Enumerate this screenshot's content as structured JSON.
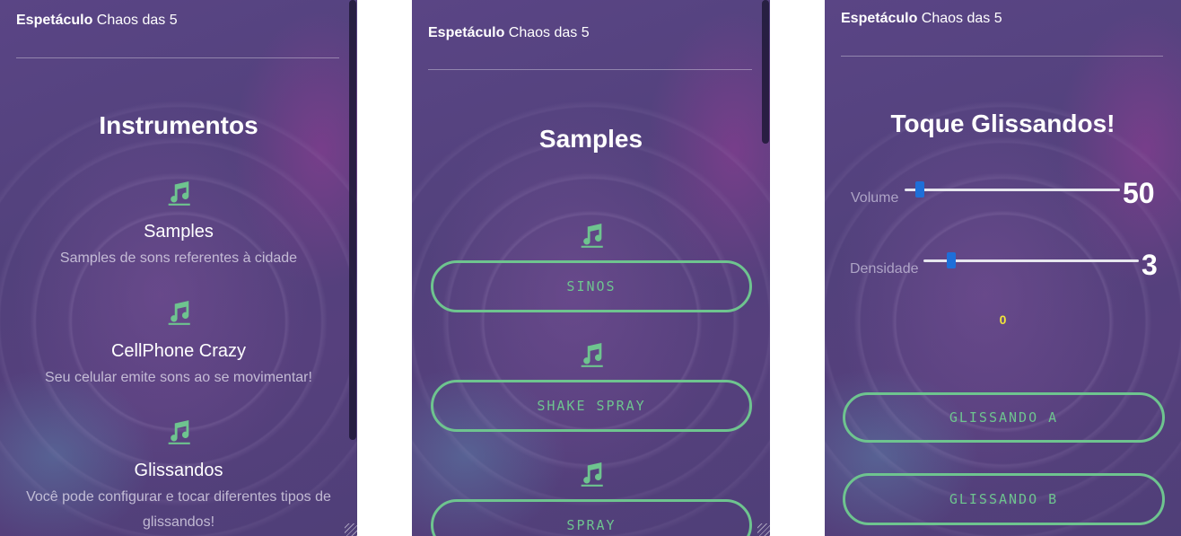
{
  "colors": {
    "accent": "#6ec48f",
    "counter": "#f2e639",
    "slider_thumb": "#1e6fd9"
  },
  "icons": {
    "note": "music-note-icon"
  },
  "panel1": {
    "brand_bold": "Espetáculo",
    "brand_rest": " Chaos das 5",
    "heading": "Instrumentos",
    "items": [
      {
        "title": "Samples",
        "desc": "Samples de sons referentes à cidade"
      },
      {
        "title": "CellPhone Crazy",
        "desc": "Seu celular emite sons ao se movimentar!"
      },
      {
        "title": "Glissandos",
        "desc": "Você pode configurar e tocar diferentes tipos de glissandos!"
      }
    ]
  },
  "panel2": {
    "brand_bold": "Espetáculo",
    "brand_rest": " Chaos das 5",
    "heading": "Samples",
    "buttons": [
      "SINOS",
      "SHAKE SPRAY",
      "SPRAY"
    ]
  },
  "panel3": {
    "brand_bold": "Espetáculo",
    "brand_rest": " Chaos das 5",
    "heading": "Toque Glissandos!",
    "volume": {
      "label": "Volume",
      "value": "50",
      "level": 0.07
    },
    "density": {
      "label": "Densidade",
      "value": "3",
      "level": 0.13
    },
    "counter": "0",
    "buttons": [
      "GLISSANDO A",
      "GLISSANDO B"
    ]
  }
}
